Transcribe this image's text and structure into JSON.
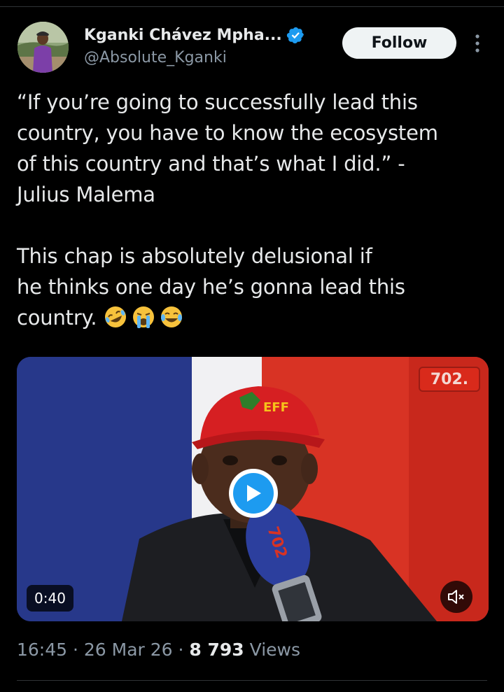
{
  "author": {
    "display_name": "Kganki Chávez Mpha...",
    "handle": "@Absolute_Kganki",
    "verified_icon": "verified-badge-icon",
    "avatar_icon": "avatar"
  },
  "actions": {
    "follow_label": "Follow",
    "more_icon": "more-vertical-icon"
  },
  "tweet": {
    "lines": [
      "“If you’re going to successfully lead this",
      "country, you have to know the ecosystem",
      "of this country and that’s what I did.” -",
      "Julius Malema",
      "This chap is absolutely delusional if",
      "he thinks one day he’s gonna lead this",
      "country."
    ],
    "emojis": [
      "rolling-on-floor-laughing-icon",
      "loudly-crying-face-icon",
      "tears-of-joy-icon"
    ]
  },
  "media": {
    "channel_badge": "702.",
    "cap_text": "EFF",
    "mic_text": "702",
    "duration": "0:40",
    "play_icon": "play-icon",
    "mute_icon": "mute-icon"
  },
  "meta": {
    "time": "16:45",
    "separator": " · ",
    "date": "26 Mar 26",
    "views_count": "8 793",
    "views_label": " Views"
  },
  "colors": {
    "background": "#000000",
    "text": "#e7e9ea",
    "muted": "#8b98a5",
    "accent": "#1d9bf0",
    "follow_bg": "#eff3f4"
  }
}
